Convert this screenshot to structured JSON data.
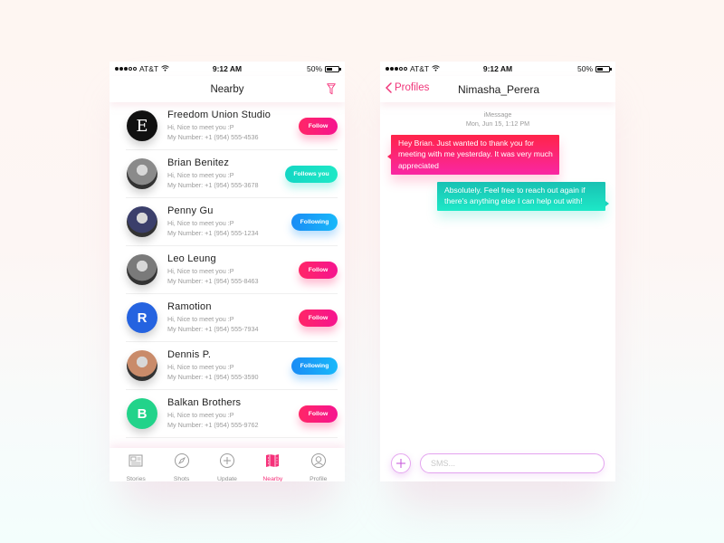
{
  "colors": {
    "accent_pink": "#f5317a",
    "follow_gradient": [
      "#ff2667",
      "#f6148f"
    ],
    "follows_you_gradient": [
      "#14d6c4",
      "#1ee8c6"
    ],
    "following_gradient": [
      "#1a8cf5",
      "#18b8fa"
    ],
    "incoming_bubble": [
      "#ff2449",
      "#f927a3"
    ],
    "outgoing_bubble": [
      "#19c1b3",
      "#1de8c7"
    ]
  },
  "status_bar": {
    "carrier": "AT&T",
    "time": "9:12 AM",
    "battery": "50%",
    "battery_level": 0.5,
    "signal_bars": 3,
    "signal_max": 5
  },
  "nearby": {
    "title": "Nearby",
    "filter_icon": "filter-icon",
    "people": [
      {
        "name": "Freedom Union Studio",
        "greeting": "Hi, Nice to meet you :P",
        "number": "My Number:  +1 (954) 555-4536",
        "button": "Follow",
        "status": "follow",
        "avatar": "E",
        "avatar_color": "#111111"
      },
      {
        "name": "Brian Benitez",
        "greeting": "Hi, Nice to meet you :P",
        "number": "My Number:  +1 (954) 555-3678",
        "button": "Follows you",
        "status": "follows-you",
        "avatar": "",
        "avatar_color": "#8a8a8a"
      },
      {
        "name": "Penny Gu",
        "greeting": "Hi, Nice to meet you :P",
        "number": "My Number:  +1 (954) 555-1234",
        "button": "Following",
        "status": "following",
        "avatar": "",
        "avatar_color": "#3b3f6b"
      },
      {
        "name": "Leo Leung",
        "greeting": "Hi, Nice to meet you :P",
        "number": "My Number:  +1 (954) 555-8463",
        "button": "Follow",
        "status": "follow",
        "avatar": "",
        "avatar_color": "#7a7a7a"
      },
      {
        "name": "Ramotion",
        "greeting": "Hi, Nice to meet you :P",
        "number": "My Number:  +1 (954) 555-7934",
        "button": "Follow",
        "status": "follow",
        "avatar": "R",
        "avatar_color": "#2563e0"
      },
      {
        "name": "Dennis P.",
        "greeting": "Hi, Nice to meet you :P",
        "number": "My Number:  +1 (954) 555-3590",
        "button": "Following",
        "status": "following",
        "avatar": "",
        "avatar_color": "#c98b6a"
      },
      {
        "name": "Balkan Brothers",
        "greeting": "Hi, Nice to meet you :P",
        "number": "My Number:  +1 (954) 555-9762",
        "button": "Follow",
        "status": "follow",
        "avatar": "B",
        "avatar_color": "#22d38a"
      }
    ],
    "tabs": [
      {
        "label": "Stories",
        "icon": "newspaper-icon",
        "active": false
      },
      {
        "label": "Shots",
        "icon": "compass-icon",
        "active": false
      },
      {
        "label": "Update",
        "icon": "plus-circle-icon",
        "active": false
      },
      {
        "label": "Nearby",
        "icon": "map-icon",
        "active": true
      },
      {
        "label": "Profile",
        "icon": "user-icon",
        "active": false
      }
    ]
  },
  "chat": {
    "back_label": "Profiles",
    "title": "Nimasha_Perera",
    "service": "iMessage",
    "timestamp": "Mon, Jun 15, 1:12 PM",
    "messages": [
      {
        "direction": "incoming",
        "text": "Hey Brian. Just wanted to thank you for meeting with me yesterday. It was very much appreciated"
      },
      {
        "direction": "outgoing",
        "text": "Absolutely. Feel free to reach out again if there's anything else I can help out with!"
      }
    ],
    "input_placeholder": "SMS...",
    "input_value": ""
  }
}
